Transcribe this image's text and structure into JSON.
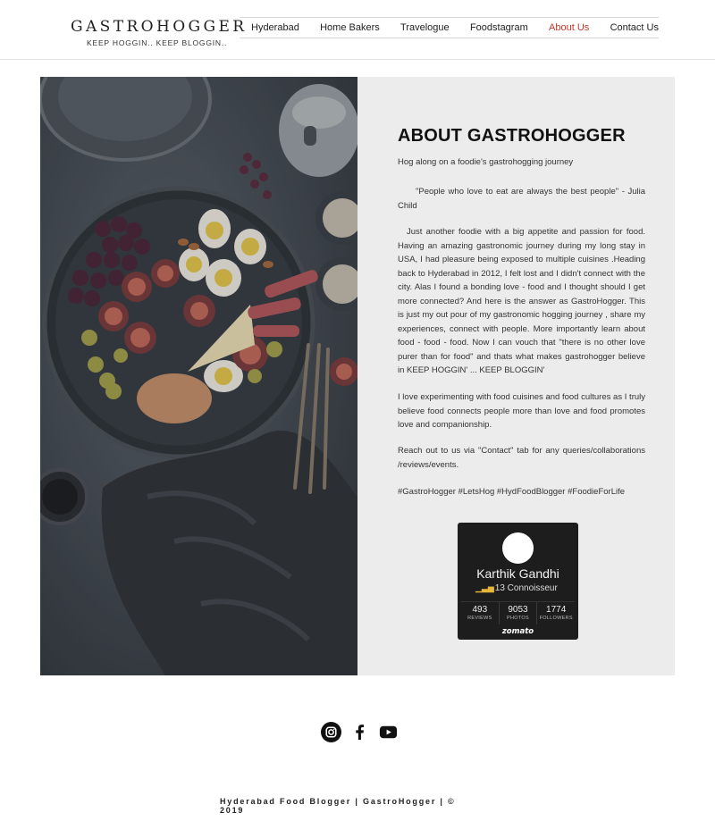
{
  "brand": {
    "title": "GASTROHOGGER",
    "tagline": "KEEP HOGGIN.. KEEP BLOGGIN.."
  },
  "nav": {
    "items": [
      "Hyderabad",
      "Home Bakers",
      "Travelogue",
      "Foodstagram",
      "About Us",
      "Contact Us"
    ],
    "active": "About Us"
  },
  "about": {
    "title": "ABOUT GASTROHOGGER",
    "subtitle": "Hog along on a foodie's gastrohogging journey",
    "quote": "\"People who love to eat are always the best people\" - Julia Child",
    "paragraph1": "Just another foodie with a big appetite and passion for food. Having an amazing gastronomic journey during my long stay in USA, I had pleasure being exposed to multiple cuisines .Heading back to Hyderabad in 2012, I felt lost and I didn't connect with the city. Alas I found a bonding love - food and I thought should I get more connected? And here is the answer as GastroHogger. This is just my out pour of my gastronomic hogging journey , share my experiences, connect with people. More importantly learn about food - food - food. Now I can vouch that \"there is no other love purer than for food\" and thats what makes gastrohogger believe in KEEP HOGGIN' ... KEEP BLOGGIN'",
    "paragraph2": "I love experimenting with food cuisines and food cultures as I truly believe food connects people more than love and food promotes love and companionship.",
    "paragraph3": "Reach out to us via \"Contact\" tab for any queries/collaborations /reviews/events.",
    "hashtags": "#GastroHogger #LetsHog #HydFoodBlogger #FoodieForLife"
  },
  "zomato": {
    "name": "Karthik Gandhi",
    "level": "13 Connoisseur",
    "stats": [
      {
        "value": "493",
        "label": "REVIEWS"
      },
      {
        "value": "9053",
        "label": "PHOTOS"
      },
      {
        "value": "1774",
        "label": "FOLLOWERS"
      }
    ],
    "logo": "zomato"
  },
  "social": {
    "icons": [
      "instagram-icon",
      "facebook-icon",
      "youtube-icon"
    ]
  },
  "footer": {
    "text": "Hyderabad Food Blogger | GastroHogger | © 2019"
  },
  "colors": {
    "active_nav": "#c0392b",
    "panel_bg": "#ececec",
    "widget_bg": "#1d1d1d",
    "hero_bg": "#3f454c"
  }
}
